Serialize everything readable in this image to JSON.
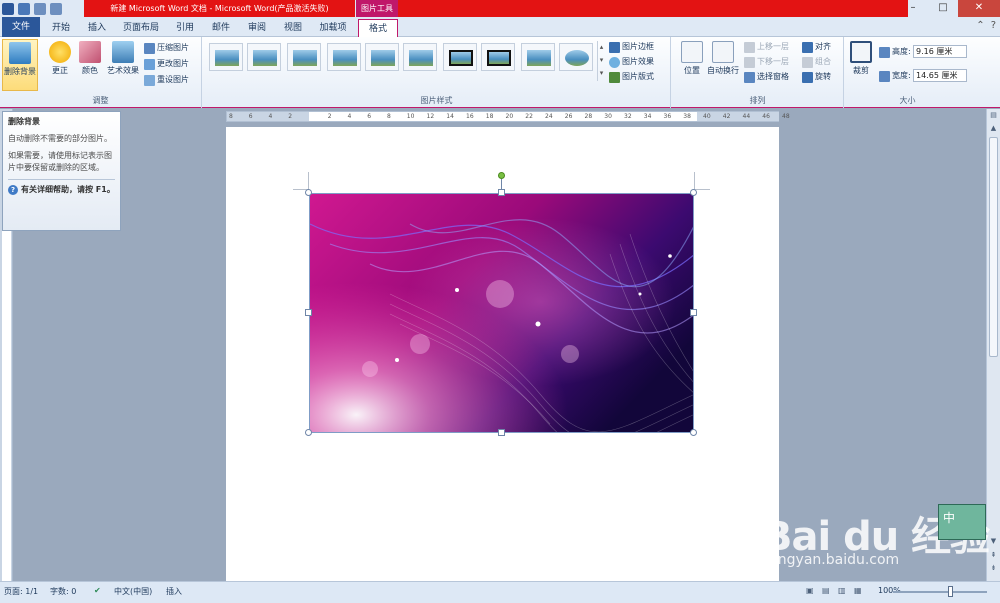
{
  "titlebar": {
    "document_title": "新建 Microsoft Word 文档 - Microsoft Word(产品激活失败)",
    "context_tab": "图片工具",
    "minimize": "–",
    "maximize": "□",
    "close": "✕"
  },
  "tabs": {
    "file": "文件",
    "items": [
      "开始",
      "插入",
      "页面布局",
      "引用",
      "邮件",
      "审阅",
      "视图",
      "加载项",
      "格式"
    ],
    "active": "格式"
  },
  "ribbon": {
    "adjust": {
      "label": "调整",
      "remove_bg": "删除背景",
      "correct": "更正",
      "color": "颜色",
      "artistic": "艺术效果",
      "compress": "压缩图片",
      "change": "更改图片",
      "reset": "重设图片"
    },
    "styles": {
      "label": "图片样式",
      "border": "图片边框",
      "effects": "图片效果",
      "layout": "图片版式"
    },
    "arrange": {
      "label": "排列",
      "position": "位置",
      "wrap": "自动换行",
      "forward": "上移一层",
      "backward": "下移一层",
      "pane": "选择窗格",
      "align": "对齐",
      "group": "组合",
      "rotate": "旋转"
    },
    "size": {
      "label": "大小",
      "crop": "裁剪",
      "height_label": "高度:",
      "height_value": "9.16 厘米",
      "width_label": "宽度:",
      "width_value": "14.65 厘米"
    }
  },
  "tooltip": {
    "title": "删除背景",
    "line1": "自动删除不需要的部分图片。",
    "line2": "如果需要，请使用标记表示图片中要保留或删除的区域。",
    "help": "有关详细帮助，请按 F1。"
  },
  "ruler": {
    "ticks": [
      "8",
      "6",
      "4",
      "2",
      "",
      "2",
      "4",
      "6",
      "8",
      "10",
      "12",
      "14",
      "16",
      "18",
      "20",
      "22",
      "24",
      "26",
      "28",
      "30",
      "32",
      "34",
      "36",
      "38",
      "40",
      "42",
      "44",
      "46",
      "48"
    ]
  },
  "statusbar": {
    "page": "页面: 1/1",
    "words": "字数: 0",
    "language": "中文(中国)",
    "mode": "插入",
    "zoom": "100%"
  },
  "watermark": {
    "brand": "Bai du 经验",
    "url": "jingyan.baidu.com"
  },
  "ime": {
    "label": "中"
  },
  "colors": {
    "title_red": "#e31313",
    "context_magenta": "#c0186a",
    "file_blue": "#2b579a"
  }
}
